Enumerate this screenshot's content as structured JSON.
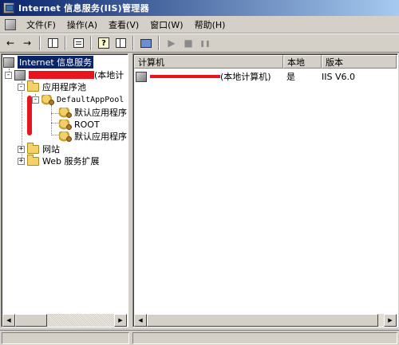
{
  "window": {
    "title": "Internet 信息服务(IIS)管理器"
  },
  "menu": {
    "items": [
      {
        "label": "文件(F)"
      },
      {
        "label": "操作(A)"
      },
      {
        "label": "查看(V)"
      },
      {
        "label": "窗口(W)"
      },
      {
        "label": "帮助(H)"
      }
    ]
  },
  "toolbar": {
    "back_label": "←",
    "forward_label": "→",
    "play_label": "▶",
    "stop_label": "■",
    "pause_label": "❚❚"
  },
  "tree": {
    "root_label": "Internet 信息服务",
    "computer_label": "(本地计",
    "app_pools_label": "应用程序池",
    "default_pool_label": "DefaultAppPool",
    "default_app_1_label": "默认应用程序",
    "root_app_label": "ROOT",
    "default_app_2_label": "默认应用程序",
    "websites_label": "网站",
    "web_ext_label": "Web 服务扩展",
    "expand_minus": "-",
    "expand_plus": "+"
  },
  "list": {
    "columns": [
      "计算机",
      "本地",
      "版本"
    ],
    "rows": [
      {
        "computer": "(本地计算机)",
        "local": "是",
        "version": "IIS V6.0"
      }
    ]
  },
  "colors": {
    "title_start": "#0a246a",
    "title_end": "#a6caf0",
    "selection": "#0a246a",
    "redaction": "#e8141e",
    "chrome": "#d4d0c8"
  }
}
